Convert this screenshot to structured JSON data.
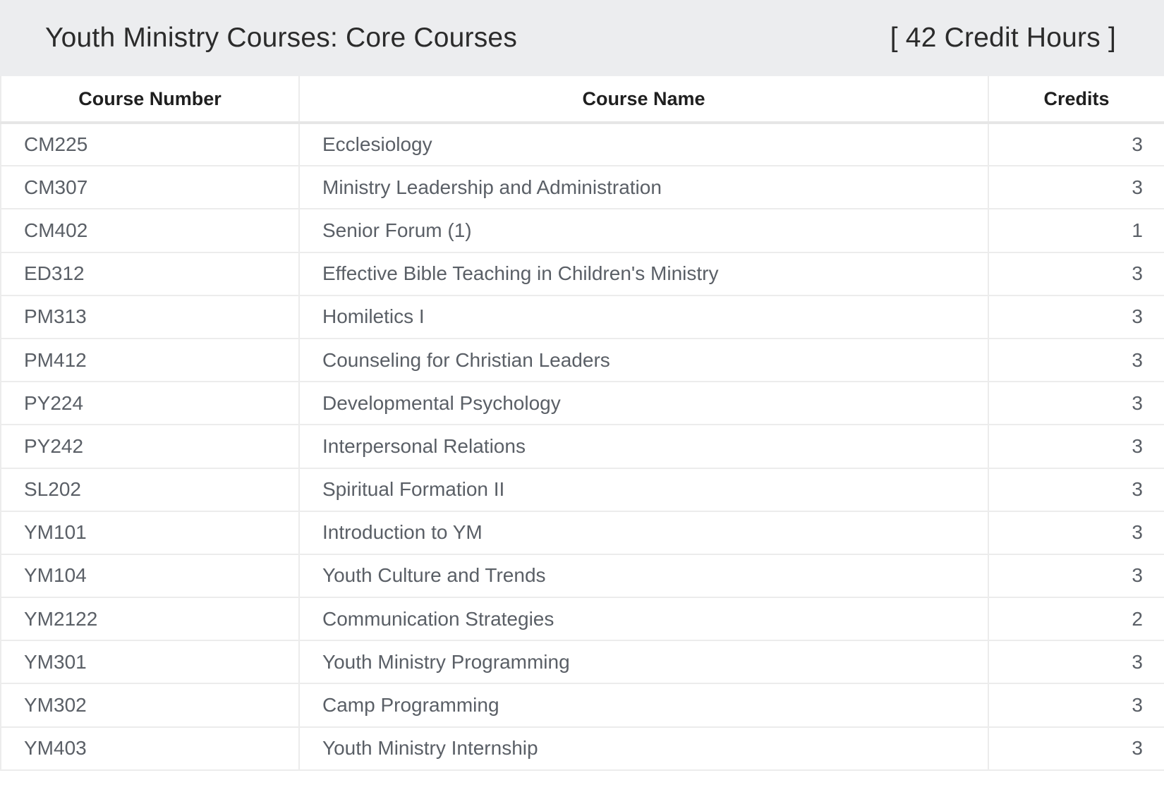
{
  "header": {
    "title": "Youth Ministry Courses: Core Courses",
    "credits": "[ 42 Credit Hours ]"
  },
  "table": {
    "columns": [
      "Course Number",
      "Course Name",
      "Credits"
    ],
    "rows": [
      {
        "number": "CM225",
        "name": "Ecclesiology",
        "credits": "3"
      },
      {
        "number": "CM307",
        "name": "Ministry Leadership and Administration",
        "credits": "3"
      },
      {
        "number": "CM402",
        "name": "Senior Forum (1)",
        "credits": "1"
      },
      {
        "number": "ED312",
        "name": "Effective Bible Teaching in Children's Ministry",
        "credits": "3"
      },
      {
        "number": "PM313",
        "name": "Homiletics I",
        "credits": "3"
      },
      {
        "number": "PM412",
        "name": "Counseling for Christian Leaders",
        "credits": "3"
      },
      {
        "number": "PY224",
        "name": "Developmental Psychology",
        "credits": "3"
      },
      {
        "number": "PY242",
        "name": "Interpersonal Relations",
        "credits": "3"
      },
      {
        "number": "SL202",
        "name": "Spiritual Formation II",
        "credits": "3"
      },
      {
        "number": "YM101",
        "name": "Introduction to YM",
        "credits": "3"
      },
      {
        "number": "YM104",
        "name": "Youth Culture and Trends",
        "credits": "3"
      },
      {
        "number": "YM2122",
        "name": "Communication Strategies",
        "credits": "2"
      },
      {
        "number": "YM301",
        "name": "Youth Ministry Programming",
        "credits": "3"
      },
      {
        "number": "YM302",
        "name": "Camp Programming",
        "credits": "3"
      },
      {
        "number": "YM403",
        "name": "Youth Ministry Internship",
        "credits": "3"
      }
    ]
  }
}
